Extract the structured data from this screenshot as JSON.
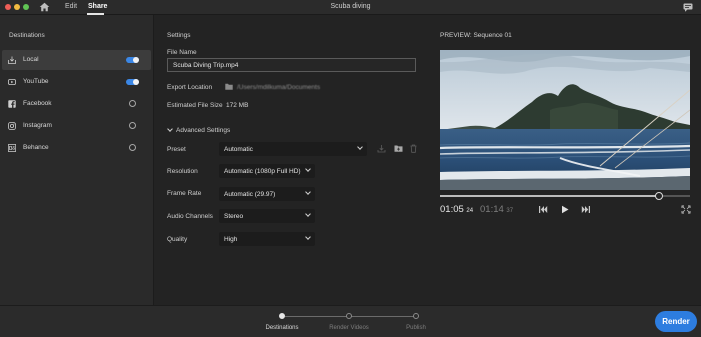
{
  "window": {
    "title": "Scuba diving",
    "nav": {
      "edit": "Edit",
      "share": "Share"
    },
    "icons": {
      "home": "home-icon",
      "feedback": "chat-feedback-icon"
    }
  },
  "destinations": {
    "heading": "Destinations",
    "items": [
      {
        "label": "Local",
        "icon": "local-drive-icon",
        "enabled": true,
        "selected": true
      },
      {
        "label": "YouTube",
        "icon": "youtube-icon",
        "enabled": true,
        "selected": false
      },
      {
        "label": "Facebook",
        "icon": "facebook-icon",
        "enabled": false,
        "selected": false
      },
      {
        "label": "Instagram",
        "icon": "instagram-icon",
        "enabled": false,
        "selected": false
      },
      {
        "label": "Behance",
        "icon": "behance-icon",
        "enabled": false,
        "selected": false
      }
    ]
  },
  "settings": {
    "heading": "Settings",
    "file_name_label": "File Name",
    "file_name_value": "Scuba Diving Trip.mp4",
    "export_location_label": "Export Location",
    "export_location_value": "/Users/mdilkuma/Documents",
    "estimated_size_label": "Estimated File Size",
    "estimated_size_value": "172 MB",
    "advanced_label": "Advanced Settings",
    "preset_label": "Preset",
    "preset_value": "Automatic",
    "resolution_label": "Resolution",
    "resolution_value": "Automatic (1080p Full HD)",
    "frame_rate_label": "Frame Rate",
    "frame_rate_value": "Automatic (29.97)",
    "audio_label": "Audio Channels",
    "audio_value": "Stereo",
    "quality_label": "Quality",
    "quality_value": "High"
  },
  "preview": {
    "heading": "PREVIEW: Sequence 01",
    "current_time": "01:05",
    "current_frames": "24",
    "total_time": "01:14",
    "total_frames": "37",
    "playhead_fraction": 0.876
  },
  "footer": {
    "steps": [
      "Destinations",
      "Render Videos",
      "Publish"
    ],
    "active_step": 0,
    "render_label": "Render"
  },
  "colors": {
    "accent": "#2d7de0",
    "toggle_on": "#3b87e6",
    "background": "#232323"
  }
}
